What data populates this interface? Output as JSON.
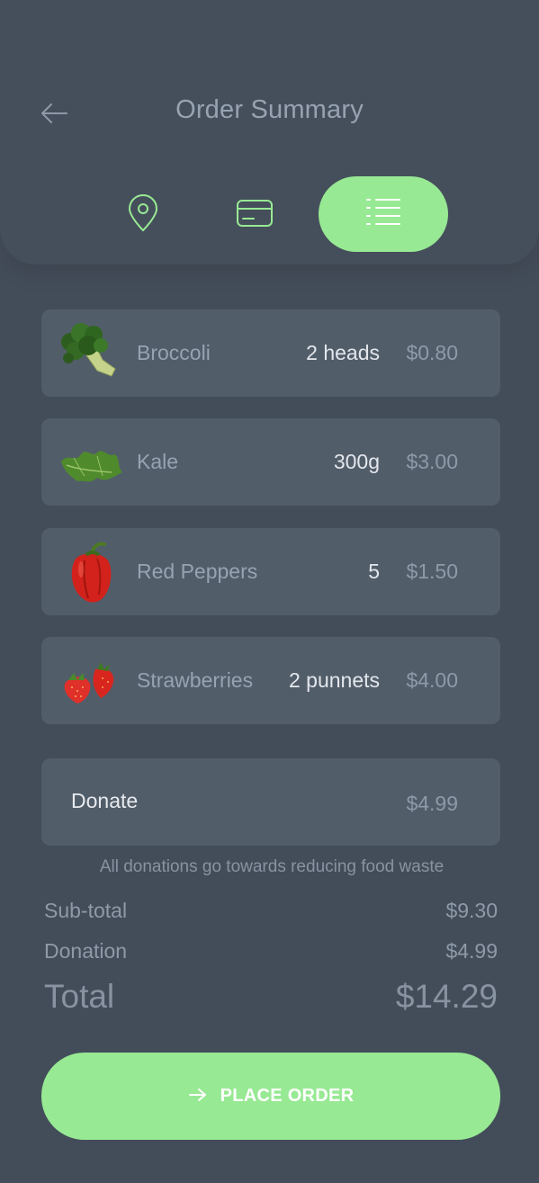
{
  "header": {
    "title": "Order Summary",
    "back_icon": "arrow-left-icon",
    "steps": [
      {
        "name": "location",
        "icon": "map-pin-icon",
        "active": false
      },
      {
        "name": "payment",
        "icon": "credit-card-icon",
        "active": false
      },
      {
        "name": "summary",
        "icon": "list-icon",
        "active": true
      }
    ]
  },
  "items": [
    {
      "name": "Broccoli",
      "qty": "2 heads",
      "price": "$0.80"
    },
    {
      "name": "Kale",
      "qty": "300g",
      "price": "$3.00"
    },
    {
      "name": "Red Peppers",
      "qty": "5",
      "price": "$1.50"
    },
    {
      "name": "Strawberries",
      "qty": "2 punnets",
      "price": "$4.00"
    }
  ],
  "donate": {
    "label": "Donate",
    "amount": "$4.99",
    "note": "All donations go towards reducing food waste"
  },
  "totals": {
    "subtotal_label": "Sub-total",
    "subtotal_value": "$9.30",
    "donation_label": "Donation",
    "donation_value": "$4.99",
    "total_label": "Total",
    "total_value": "$14.29"
  },
  "place_order": {
    "label": "PLACE ORDER",
    "icon": "arrow-right-icon"
  },
  "colors": {
    "background": "#434d59",
    "card": "#525d6a",
    "accent": "#98e994"
  }
}
